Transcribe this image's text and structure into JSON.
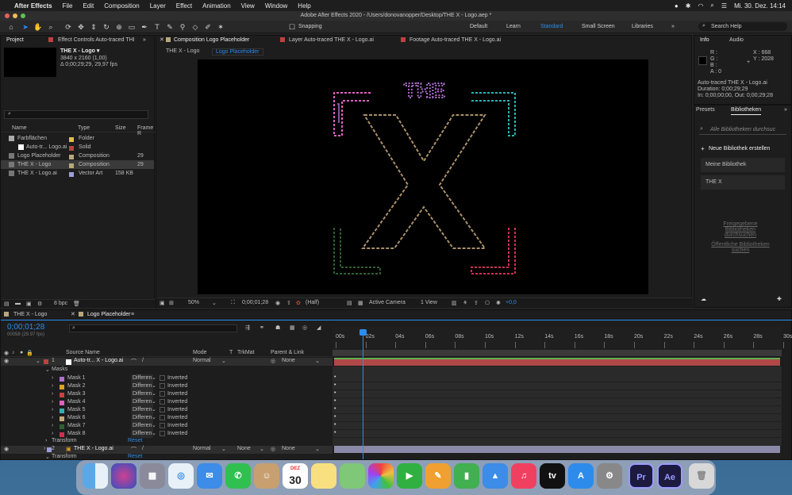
{
  "menubar": {
    "app": "After Effects",
    "items": [
      "File",
      "Edit",
      "Composition",
      "Layer",
      "Effect",
      "Animation",
      "View",
      "Window",
      "Help"
    ],
    "datetime": "Mi. 30. Dez.  14:14"
  },
  "window": {
    "title": "Adobe After Effects 2020 - /Users/donovanopper/Desktop/THE X - Logo.aep *"
  },
  "toolbar": {
    "snapping": "Snapping",
    "workspaces": [
      "Default",
      "Learn",
      "Standard",
      "Small Screen",
      "Libraries"
    ],
    "search": "Search Help"
  },
  "project": {
    "tab": "Project",
    "effect_tab": "Effect Controls Auto-traced THE X",
    "preview": {
      "name": "THE X - Logo ▾",
      "line1": "3840 x 2160 (1,00)",
      "line2": "Δ 0;00;29;29, 29,97 fps"
    },
    "columns": [
      "Name",
      "Type",
      "Size",
      "Frame R"
    ],
    "items": [
      {
        "name": "Farbflächen",
        "type": "Folder",
        "size": "",
        "fps": "",
        "color": "#e0c040"
      },
      {
        "name": "Auto-tr... Logo.ai",
        "type": "Solid",
        "size": "",
        "fps": "",
        "color": "#c04040"
      },
      {
        "name": "Logo Placeholder",
        "type": "Composition",
        "size": "",
        "fps": "29",
        "color": "#b8a87a"
      },
      {
        "name": "THE X - Logo",
        "type": "Composition",
        "size": "",
        "fps": "29",
        "color": "#b8a87a"
      },
      {
        "name": "THE X - Logo.ai",
        "type": "Vector Art",
        "size": "158 KB",
        "fps": "",
        "color": "#9e9ed8"
      }
    ],
    "bpc": "8 bpc"
  },
  "comp": {
    "tabs": [
      "Composition Logo Placeholder",
      "Layer Auto-traced THE X - Logo.ai",
      "Footage Auto-traced THE X - Logo.ai"
    ],
    "crumbs": [
      "THE X - Logo",
      "Logo Placeholder"
    ],
    "footer": {
      "zoom": "50%",
      "time": "0;00;01;28",
      "res": "(Half)",
      "camera": "Active Camera",
      "view": "1 View",
      "exposure": "+0,0"
    },
    "logo_text": "THE"
  },
  "info": {
    "tab": "Info",
    "audio": "Audio",
    "r": "R :",
    "g": "G :",
    "b": "B :",
    "a": "A :  0",
    "x": "X : 668",
    "y": "Y : 2028",
    "line1": "Auto-traced THE X - Logo.ai",
    "line2": "Duration: 0;00;29;29",
    "line3": "In: 0;00;00;00, Out: 0;00;29;28"
  },
  "libraries": {
    "tabs": [
      "Presets",
      "Bibliotheken"
    ],
    "search": "Alle Bibliotheken durchsuc",
    "new": "Neue Bibliothek erstellen",
    "items": [
      "Meine Bibliothek",
      "THE X"
    ],
    "links": [
      "Freigegebene Bibliotheken durchsuchen",
      "Öffentliche Bibliotheken suchen"
    ]
  },
  "timeline": {
    "tabs": [
      "THE X - Logo",
      "Logo Placeholder"
    ],
    "time": "0;00;01;28",
    "fps_line": "00058 (29.97 fps)",
    "columns": [
      "Source Name",
      "Mode",
      "T",
      "TrkMat",
      "Parent & Link"
    ],
    "ruler": [
      "00s",
      "02s",
      "04s",
      "06s",
      "08s",
      "10s",
      "12s",
      "14s",
      "16s",
      "18s",
      "20s",
      "22s",
      "24s",
      "26s",
      "28s",
      "30s"
    ],
    "layer1": {
      "num": "1",
      "name": "Auto-tr... X - Logo.ai",
      "mode": "Normal",
      "parent": "None"
    },
    "masks_label": "Masks",
    "masks": [
      {
        "name": "Mask 1",
        "mode": "Differen",
        "color": "#b070d0"
      },
      {
        "name": "Mask 2",
        "mode": "Differen",
        "color": "#e0a020"
      },
      {
        "name": "Mask 3",
        "mode": "Differen",
        "color": "#d04040"
      },
      {
        "name": "Mask 4",
        "mode": "Differen",
        "color": "#e060c0"
      },
      {
        "name": "Mask 5",
        "mode": "Differen",
        "color": "#30b0b0"
      },
      {
        "name": "Mask 6",
        "mode": "Differen",
        "color": "#c8a878"
      },
      {
        "name": "Mask 7",
        "mode": "Differen",
        "color": "#306030"
      },
      {
        "name": "Mask 8",
        "mode": "Differen",
        "color": "#d03050"
      }
    ],
    "inverted": "Inverted",
    "transform": "Transform",
    "reset": "Reset",
    "layer2": {
      "num": "2",
      "name": "THE X - Logo.ai",
      "mode": "Normal",
      "trkmat": "None",
      "parent": "None"
    }
  },
  "dock": {
    "apps": [
      "Finder",
      "Siri",
      "Launchpad",
      "Safari",
      "Mail",
      "WhatsApp",
      "Contacts",
      "Calendar",
      "Notes",
      "Maps",
      "Photos",
      "FaceTime",
      "Pages",
      "Numbers",
      "Keynote",
      "Music",
      "TV",
      "App Store",
      "System Preferences",
      "Premiere Pro",
      "After Effects",
      "Trash"
    ],
    "calendar_month": "DEZ",
    "calendar_day": "30",
    "pr": "Pr",
    "ae": "Ae",
    "tv": "tv"
  }
}
